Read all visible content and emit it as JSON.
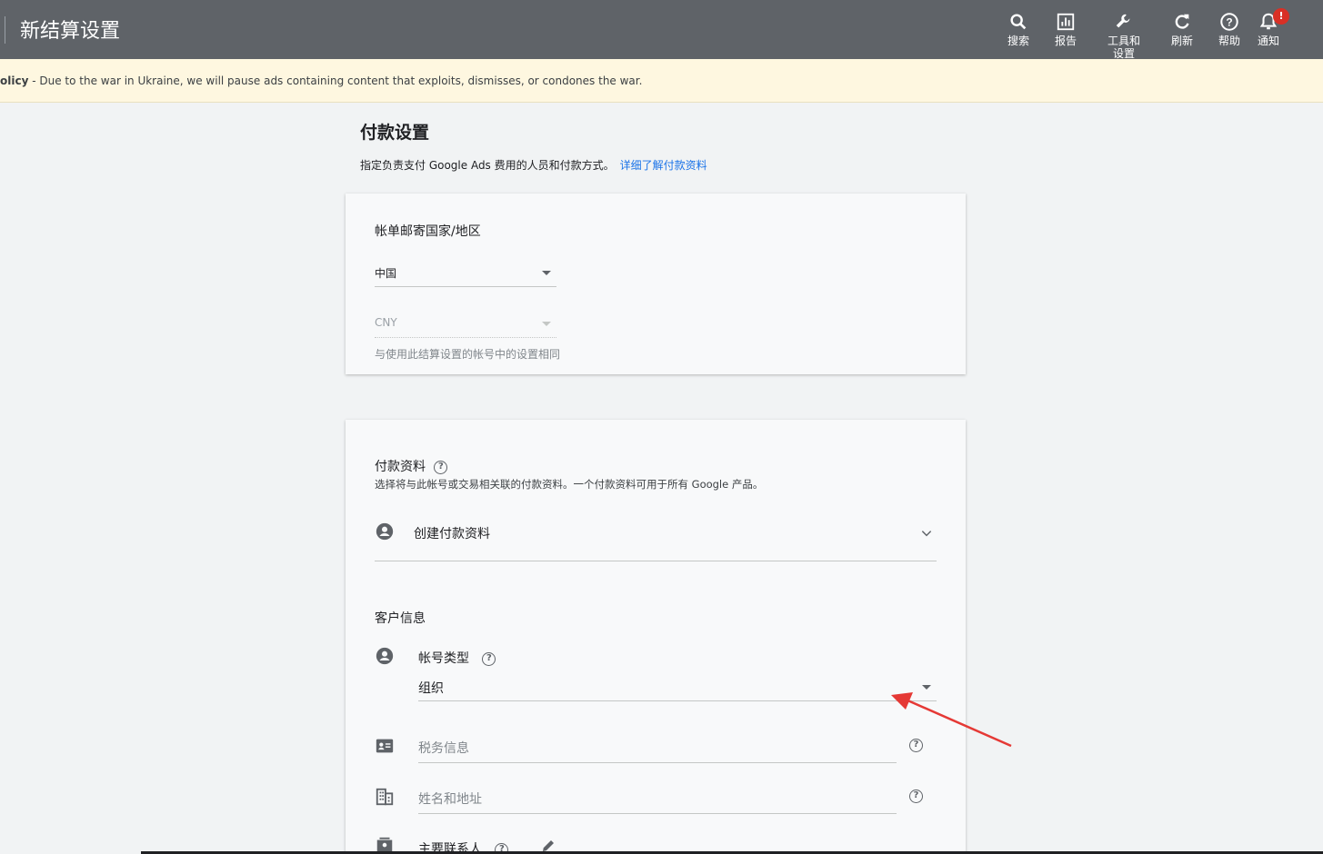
{
  "header": {
    "title": "新结算设置",
    "tools": [
      {
        "label": "搜索",
        "icon": "search-icon"
      },
      {
        "label": "报告",
        "icon": "reports-icon"
      },
      {
        "label": "工具和\n设置",
        "icon": "wrench-icon"
      },
      {
        "label": "刷新",
        "icon": "refresh-icon"
      },
      {
        "label": "帮助",
        "icon": "help-icon"
      },
      {
        "label": "通知",
        "icon": "bell-icon"
      }
    ],
    "notification_badge": "!"
  },
  "notice": {
    "prefix": "olicy",
    "text": " - Due to the war in Ukraine, we will pause ads containing content that exploits, dismisses, or condones the war."
  },
  "page": {
    "title": "付款设置",
    "subtitle": "指定负责支付 Google Ads 费用的人员和付款方式。",
    "learn_more": "详细了解付款资料"
  },
  "billing_country": {
    "label": "帐单邮寄国家/地区",
    "country_value": "中国",
    "currency_value": "CNY",
    "currency_hint": "与使用此结算设置的帐号中的设置相同"
  },
  "payments_profile": {
    "label": "付款资料",
    "description": "选择将与此帐号或交易相关联的付款资料。一个付款资料可用于所有 Google 产品。",
    "selected": "创建付款资料"
  },
  "customer_info": {
    "heading": "客户信息",
    "account_type_label": "帐号类型",
    "account_type_value": "组织",
    "tax_info_placeholder": "税务信息",
    "name_address_placeholder": "姓名和地址",
    "primary_contact_label": "主要联系人"
  },
  "colors": {
    "topbar": "#5f6368",
    "notice_bg": "#fef7e0",
    "link": "#1a73e8",
    "annotation_arrow": "#e53935"
  }
}
